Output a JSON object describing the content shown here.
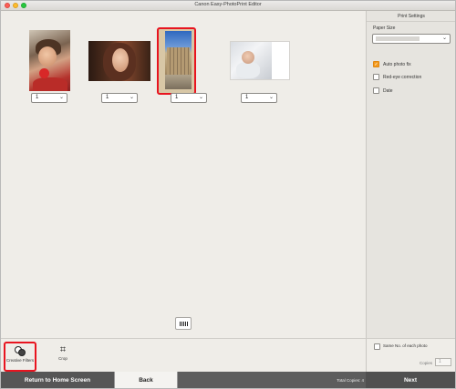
{
  "window": {
    "title": "Canon Easy-PhotoPrint Editor"
  },
  "photos": [
    {
      "name": "girl-red-ball",
      "copies": "1"
    },
    {
      "name": "woman-portrait",
      "copies": "1"
    },
    {
      "name": "building-plaza",
      "copies": "1",
      "selected": true
    },
    {
      "name": "baby-white",
      "copies": "1"
    }
  ],
  "right_panel": {
    "heading": "Print Settings",
    "paper_size_label": "Paper Size",
    "auto_photo_fix": {
      "label": "Auto photo fix",
      "checked": true
    },
    "red_eye": {
      "label": "Red-eye correction",
      "checked": false
    },
    "date": {
      "label": "Date",
      "checked": false
    }
  },
  "tools": {
    "creative_filters": {
      "label": "Creative Filters",
      "icon": "creative-filters-icon",
      "selected": true
    },
    "crop": {
      "label": "Crop",
      "icon": "crop-icon"
    }
  },
  "same_no": {
    "label": "Same No. of each photo",
    "checked": false,
    "copies_label": "Copies",
    "copies_value": "1"
  },
  "footer": {
    "home_label": "Return to Home Screen",
    "back_label": "Back",
    "total_copies": "Total Copies: 4",
    "next_label": "Next"
  },
  "colors": {
    "accent_selection": "#e8141f",
    "checkbox_on": "#f39a1e",
    "footer_bg": "#5d5d5d"
  }
}
